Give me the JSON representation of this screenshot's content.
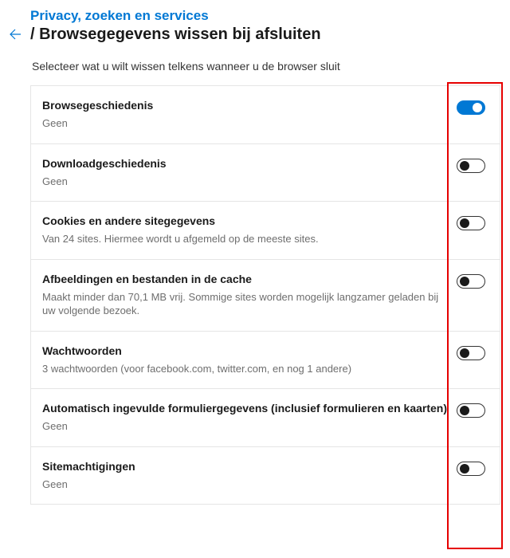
{
  "header": {
    "breadcrumb": "Privacy, zoeken en services",
    "page_title": "/ Browsegegevens wissen bij afsluiten"
  },
  "subtitle": "Selecteer wat u wilt wissen telkens wanneer u de browser sluit",
  "items": [
    {
      "title": "Browsegeschiedenis",
      "desc": "Geen",
      "on": true
    },
    {
      "title": "Downloadgeschiedenis",
      "desc": "Geen",
      "on": false
    },
    {
      "title": "Cookies en andere sitegegevens",
      "desc": "Van 24 sites. Hiermee wordt u afgemeld op de meeste sites.",
      "on": false
    },
    {
      "title": "Afbeeldingen en bestanden in de cache",
      "desc": "Maakt minder dan 70,1 MB vrij. Sommige sites worden mogelijk langzamer geladen bij uw volgende bezoek.",
      "on": false
    },
    {
      "title": "Wachtwoorden",
      "desc": "3 wachtwoorden (voor facebook.com, twitter.com, en nog 1 andere)",
      "on": false
    },
    {
      "title": "Automatisch ingevulde formuliergegevens (inclusief formulieren en kaarten)",
      "desc": "Geen",
      "on": false
    },
    {
      "title": "Sitemachtigingen",
      "desc": "Geen",
      "on": false
    }
  ]
}
